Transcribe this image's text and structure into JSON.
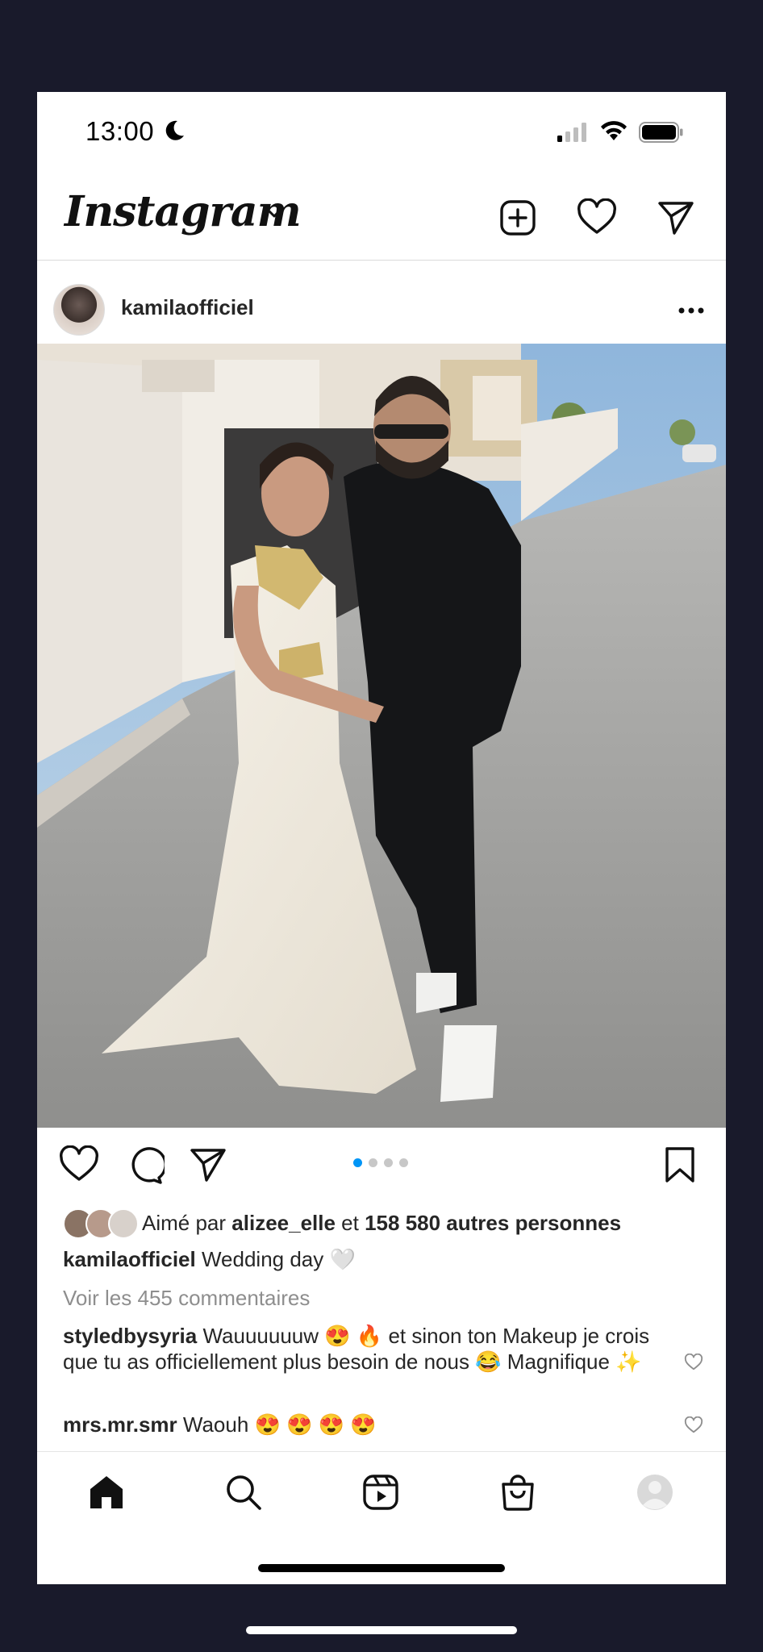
{
  "status_bar": {
    "time": "13:00"
  },
  "header": {
    "logo_text": "Instagram",
    "icons": [
      "new-post-icon",
      "heart-icon",
      "direct-icon"
    ]
  },
  "post": {
    "username": "kamilaofficiel",
    "carousel": {
      "count": 4,
      "active": 1
    },
    "likes": {
      "prefix": "Aimé par",
      "first_liker": "alizee_elle",
      "joiner": "et",
      "others": "158 580 autres personnes"
    },
    "caption": {
      "username": "kamilaofficiel",
      "text": "Wedding day 🤍"
    },
    "view_comments": "Voir les 455 commentaires",
    "comments": [
      {
        "username": "styledbysyria",
        "text": "Wauuuuuuw 😍 🔥 et sinon ton Makeup je crois que tu as officiellement plus besoin de nous 😂 Magnifique ✨"
      },
      {
        "username": "mrs.mr.smr",
        "text": "Waouh 😍 😍 😍 😍"
      }
    ]
  },
  "tabbar": {
    "items": [
      "home-icon",
      "search-icon",
      "reels-icon",
      "shop-icon",
      "profile-icon"
    ]
  },
  "colors": {
    "accent": "#0095f6",
    "background": "#191a2b",
    "text": "#262626",
    "muted": "#8e8e8e"
  }
}
